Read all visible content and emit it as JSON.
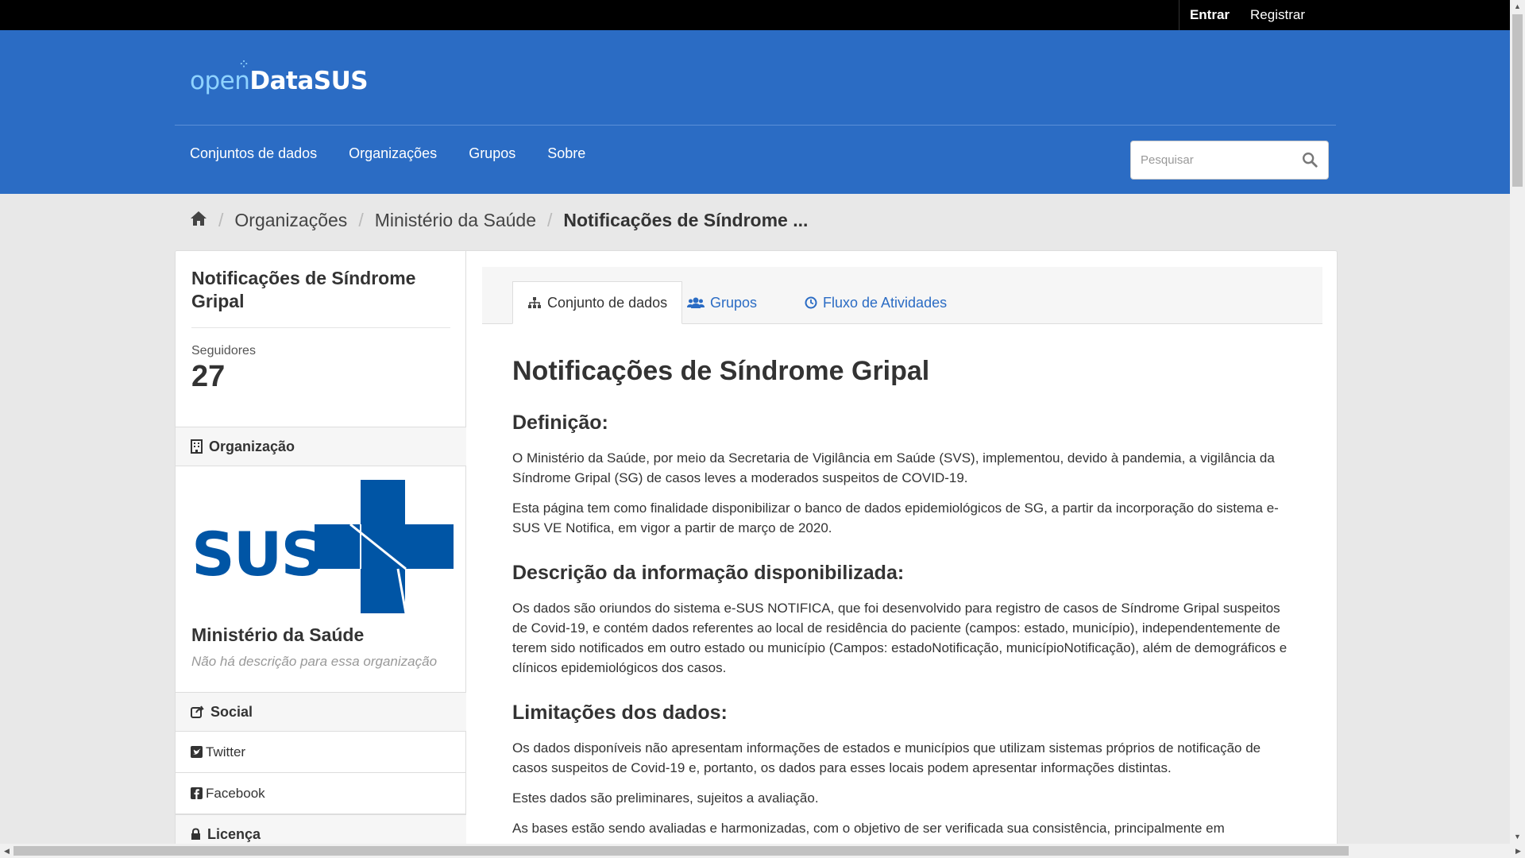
{
  "account": {
    "login_label": "Entrar",
    "register_label": "Registrar"
  },
  "brand": {
    "open": "open",
    "data": "DataSUS"
  },
  "nav": {
    "items": [
      "Conjuntos de dados",
      "Organizações",
      "Grupos",
      "Sobre"
    ]
  },
  "search": {
    "placeholder": "Pesquisar"
  },
  "breadcrumb": {
    "items": [
      "Organizações",
      "Ministério da Saúde",
      "Notificações de Síndrome ..."
    ]
  },
  "sidebar": {
    "title": "Notificações de Síndrome Gripal",
    "followers_label": "Seguidores",
    "followers_value": "27",
    "org_heading": "Organização",
    "org_logo_text": "SUS",
    "org_name": "Ministério da Saúde",
    "org_desc": "Não há descrição para essa organização",
    "social_heading": "Social",
    "social_links": [
      "Twitter",
      "Facebook"
    ],
    "license_heading": "Licença"
  },
  "tabs": {
    "items": [
      "Conjunto de dados",
      "Grupos",
      "Fluxo de Atividades"
    ]
  },
  "article": {
    "title": "Notificações de Síndrome Gripal",
    "h_definicao": "Definição:",
    "p1": "O Ministério da Saúde, por meio da Secretaria de Vigilância em Saúde (SVS), implementou, devido à pandemia, a vigilância da Síndrome Gripal (SG) de casos leves a moderados suspeitos de COVID-19.",
    "p2": "Esta página tem como finalidade disponibilizar o banco de dados epidemiológicos de SG, a partir da incorporação do sistema e-SUS VE Notifica, em vigor a partir de março de 2020.",
    "h_descricao": "Descrição da informação disponibilizada:",
    "p3": "Os dados são oriundos do sistema e-SUS NOTIFICA, que foi desenvolvido para registro de casos de Síndrome Gripal suspeitos de Covid-19, e contém dados referentes ao local de residência do paciente (campos: estado, município), independentemente de terem sido notificados em outro estado ou município (Campos: estadoNotificação, municípioNotificação), além de demográficos e clínicos epidemiológicos dos casos.",
    "h_limitacoes": "Limitações dos dados:",
    "p4": "Os dados disponíveis não apresentam informações de estados e municípios que utilizam sistemas próprios de notificação de casos suspeitos de Covid-19 e, portanto, os dados para esses locais podem apresentar informações distintas.",
    "p5": "Estes dados são preliminares, sujeitos a avaliação.",
    "p6": "As bases estão sendo avaliadas e harmonizadas, com o objetivo de ser verificada sua consistência, principalmente em"
  },
  "colors": {
    "masthead": "#2b6cc4",
    "account_bar": "#000000",
    "sus_blue": "#0055a5"
  }
}
